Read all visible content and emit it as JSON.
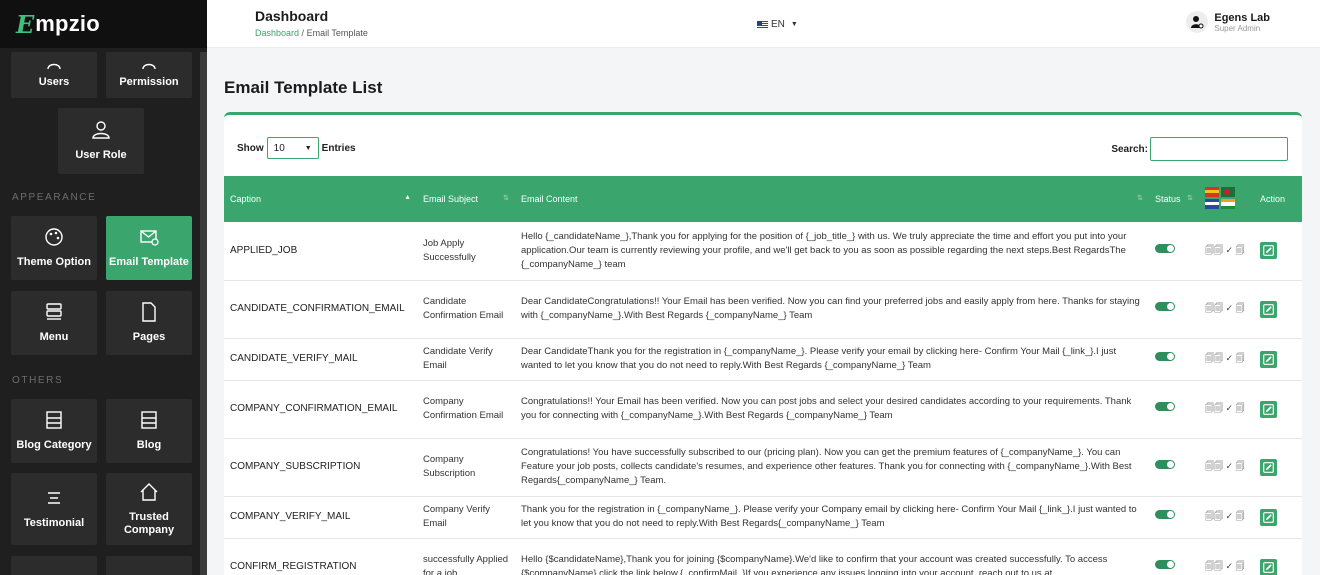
{
  "brand": {
    "mark": "E",
    "text": "mpzio"
  },
  "sidebar": {
    "tiles": {
      "users": "Users",
      "permission": "Permission",
      "user_role": "User Role",
      "theme_option": "Theme Option",
      "email_template": "Email Template",
      "menu": "Menu",
      "pages": "Pages",
      "blog_category": "Blog Category",
      "blog": "Blog",
      "testimonial": "Testimonial",
      "trusted_company_1": "Trusted",
      "trusted_company_2": "Company"
    },
    "sections": {
      "appearance": "APPEARANCE",
      "others": "OTHERS"
    },
    "active": "Email Template",
    "accent": "#3aa56c"
  },
  "header": {
    "title": "Dashboard",
    "breadcrumb": {
      "home": "Dashboard",
      "sep": "/",
      "current": "Email Template"
    },
    "language": "EN",
    "user": {
      "name": "Egens Lab",
      "role": "Super Admin"
    }
  },
  "main": {
    "title": "Email Template List",
    "show_label": "Show",
    "entries_value": "10",
    "entries_label": "Entries",
    "search_label": "Search:",
    "search_value": ""
  },
  "table": {
    "headers": {
      "caption": "Caption",
      "subject": "Email Subject",
      "content": "Email Content",
      "status": "Status",
      "action": "Action"
    },
    "rows": [
      {
        "caption": "APPLIED_JOB",
        "subject": "Job Apply Successfully",
        "content": "Hello {_candidateName_},Thank you for applying for the position of {_job_title_} with us. We truly appreciate the time and effort you put into your application.Our team is currently reviewing your profile, and we'll get back to you as soon as possible regarding the next steps.Best RegardsThe {_companyName_} team",
        "status": "on"
      },
      {
        "caption": "CANDIDATE_CONFIRMATION_EMAIL",
        "subject": "Candidate Confirmation Email",
        "content": "Dear CandidateCongratulations!! Your Email has been verified. Now you can find your preferred jobs and easily apply from here. Thanks for staying with {_companyName_}.With Best Regards {_companyName_} Team",
        "status": "on"
      },
      {
        "caption": "CANDIDATE_VERIFY_MAIL",
        "subject": "Candidate Verify Email",
        "content": "Dear CandidateThank you for the registration in {_companyName_}. Please verify your email by clicking here- Confirm Your Mail {_link_}.I just wanted to let you know that you do not need to reply.With Best Regards {_companyName_} Team",
        "status": "on"
      },
      {
        "caption": "COMPANY_CONFIRMATION_EMAIL",
        "subject": "Company Confirmation Email",
        "content": "Congratulations!! Your Email has been verified. Now you can post jobs and select your desired candidates according to your requirements. Thank you for connecting with {_companyName_}.With Best Regards {_companyName_} Team",
        "status": "on"
      },
      {
        "caption": "COMPANY_SUBSCRIPTION",
        "subject": "Company Subscription",
        "content": "Congratulations! You have successfully subscribed to our (pricing plan). Now you can get the premium features of {_companyName_}. You can Feature your job posts, collects candidate's resumes, and experience other features. Thank you for connecting with {_companyName_}.With Best Regards{_companyName_} Team.",
        "status": "on"
      },
      {
        "caption": "COMPANY_VERIFY_MAIL",
        "subject": "Company Verify Email",
        "content": "Thank you for the registration in {_companyName_}. Please verify your Company email by clicking here- Confirm Your Mail {_link_}.I just wanted to let you know that you do not need to reply.With Best Regards{_companyName_} Team",
        "status": "on"
      },
      {
        "caption": "CONFIRM_REGISTRATION",
        "subject": "successfully Applied for a job",
        "content": "Hello {$candidateName},Thank you for joining {$companyName}.We'd like to confirm that your account was created successfully. To access {$companyName} click the link below.{_confirmMail_}If you experience any issues logging into your account, reach out to us at",
        "status": "on"
      }
    ],
    "language_glyph": "🗐🗐 ✓ 🗐"
  }
}
